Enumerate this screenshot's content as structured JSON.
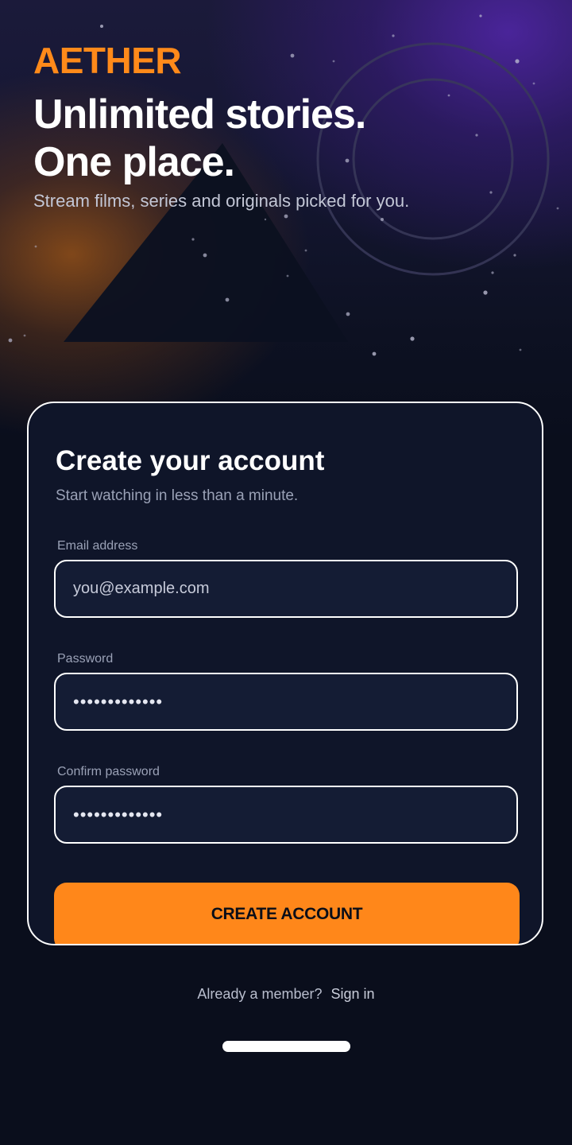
{
  "brand": {
    "name": "AETHER",
    "accent_color": "#ff8a1a"
  },
  "hero": {
    "headline_line1": "Unlimited stories.",
    "headline_line2": "One place.",
    "tagline": "Stream films, series and originals picked for you."
  },
  "signup_card": {
    "title": "Create your account",
    "subtitle": "Start watching in less than a minute.",
    "email": {
      "label": "Email address",
      "placeholder": "you@example.com",
      "value": ""
    },
    "password": {
      "label": "Password",
      "value": "•••••••••••••"
    },
    "confirm_password": {
      "label": "Confirm password",
      "value": "•••••••••••••"
    },
    "submit_label": "CREATE ACCOUNT"
  },
  "footer": {
    "prompt": "Already a member?",
    "signin_link": "Sign in"
  },
  "colors": {
    "background": "#0a0e1c",
    "card": "#0f1529",
    "cta": "#ff871a",
    "purple_glow": "#5226aa",
    "orange_glow": "#a55814"
  }
}
